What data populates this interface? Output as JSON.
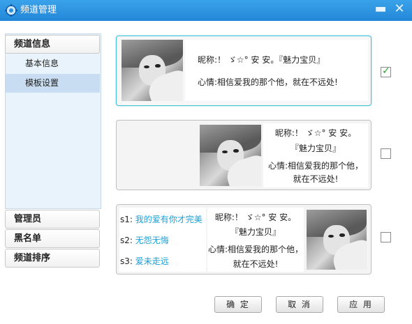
{
  "window": {
    "title": "频道管理",
    "minimize_glyph": "▬",
    "close_glyph": "✕"
  },
  "sidebar": {
    "sections": [
      {
        "label": "频道信息"
      },
      {
        "label": "管理员"
      },
      {
        "label": "黑名单"
      },
      {
        "label": "频道排序"
      }
    ],
    "sub_items": [
      {
        "label": "基本信息",
        "active": false
      },
      {
        "label": "模板设置",
        "active": true
      }
    ]
  },
  "templates": [
    {
      "selected": true,
      "nickname_label": "昵称:",
      "nickname": "！ ゞ☆° 安  安。『魅力宝贝』",
      "mood_label": "心情:",
      "mood": "相信爱我的那个他，就在不远处!"
    },
    {
      "selected": false,
      "nickname_line1": "昵称:！ ゞ☆° 安  安。",
      "nickname_line2": "『魅力宝贝』",
      "mood_line1": "心情:相信爱我的那个他，",
      "mood_line2": "就在不远处!"
    },
    {
      "selected": false,
      "sig1_label": "s1:",
      "sig1": "我的爱有你才完美",
      "sig2_label": "s2:",
      "sig2": "无怨无悔",
      "sig3_label": "s3:",
      "sig3": "爱未走远",
      "nickname_line1": "昵称:！ ゞ☆° 安  安。",
      "nickname_line2": "『魅力宝贝』",
      "mood_line1": "心情:相信爱我的那个他，",
      "mood_line2": "就在不远处!"
    }
  ],
  "buttons": {
    "ok": "确 定",
    "cancel": "取 消",
    "apply": "应 用"
  },
  "icons": {
    "app": "gear-icon",
    "checkmark": "✓"
  },
  "colors": {
    "titlebar": "#2a8fe0",
    "accent": "#1aa0d8",
    "selected_border": "#49c2d9"
  }
}
